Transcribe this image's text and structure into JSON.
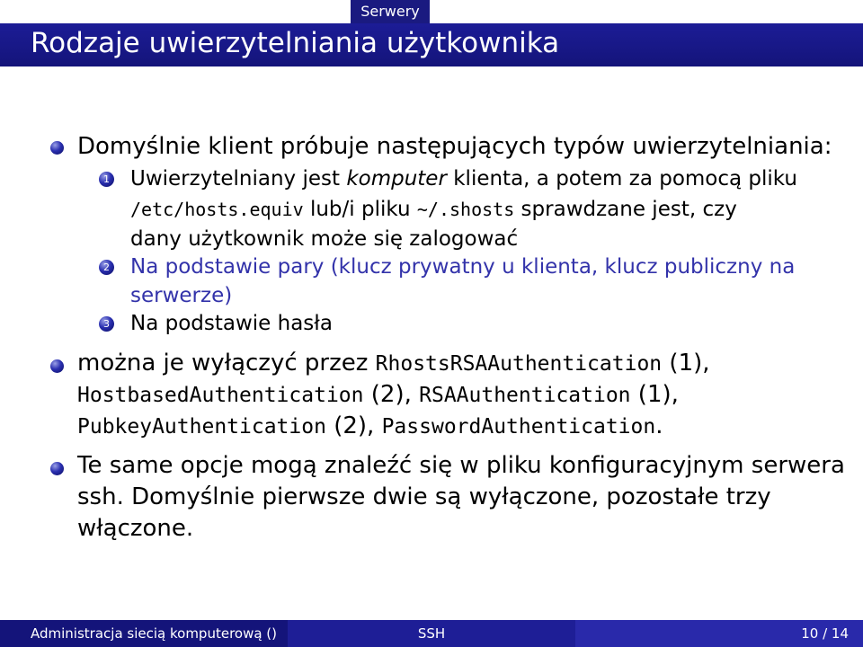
{
  "header": {
    "section": "Serwery"
  },
  "title": "Rodzaje uwierzytelniania użytkownika",
  "bullets": {
    "b1": {
      "text": "Domyślnie klient próbuje następujących typów uwierzytelniania:"
    },
    "items": [
      {
        "number": "1",
        "lines": {
          "l1a": "Uwierzytelniany jest ",
          "l1b": "komputer",
          "l1c": " klienta, a potem za pomocą pliku",
          "l2a": "/etc/hosts.equiv",
          "l2b": " lub/i pliku ",
          "l2c": "~/.shosts",
          "l2d": " sprawdzane jest, czy",
          "l3": "dany użytkownik może się zalogować"
        }
      },
      {
        "number": "2",
        "lines": {
          "l1": "Na podstawie pary (klucz prywatny u klienta, klucz publiczny na",
          "l2": "serwerze)"
        }
      },
      {
        "number": "3",
        "lines": {
          "l1": "Na podstawie hasła"
        }
      }
    ],
    "b2": {
      "l1a": "można je wyłączyć przez ",
      "l1b": "RhostsRSAAuthentication",
      "l1c": " (1),",
      "l2a": "HostbasedAuthentication",
      "l2b": " (2), ",
      "l2c": "RSAAuthentication",
      "l2d": " (1),",
      "l3a": "PubkeyAuthentication",
      "l3b": " (2), ",
      "l3c": "PasswordAuthentication",
      "l3d": "."
    },
    "b3": {
      "l1": "Te same opcje mogą znaleźć się w pliku konfiguracyjnym serwera",
      "l2": "ssh. Domyślnie pierwsze dwie są wyłączone, pozostałe trzy",
      "l3": "włączone."
    }
  },
  "footer": {
    "left": "Administracja siecią komputerową  ()",
    "middle": "SSH",
    "right": "10 / 14"
  },
  "colors": {
    "title_bar": "#14147a",
    "accent_text": "#3333aa",
    "bullet": "#2a2fb0"
  }
}
